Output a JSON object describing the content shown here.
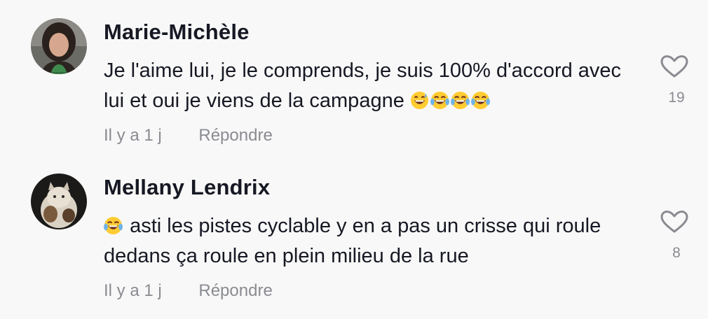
{
  "comments": [
    {
      "username": "Marie-Michèle",
      "text": "Je l'aime lui, je le comprends, je suis 100% d'accord avec lui et oui je viens de la campagne",
      "emojis": [
        "grinning-sweat-emoji",
        "tears-of-joy-emoji",
        "tears-of-joy-emoji",
        "tears-of-joy-emoji"
      ],
      "time": "Il y a 1 j",
      "reply_label": "Répondre",
      "likes": "19"
    },
    {
      "username": "Mellany Lendrix",
      "text": "asti les pistes cyclable y en a pas un crisse qui roule dedans ça roule en plein milieu de la rue",
      "emojis_leading": [
        "tears-of-joy-emoji"
      ],
      "time": "Il y a 1 j",
      "reply_label": "Répondre",
      "likes": "8"
    }
  ],
  "colors": {
    "background": "#f8f8f8",
    "primary_text": "#161823",
    "secondary_text": "#8a8b91",
    "heart_outline": "#8a8b91"
  }
}
